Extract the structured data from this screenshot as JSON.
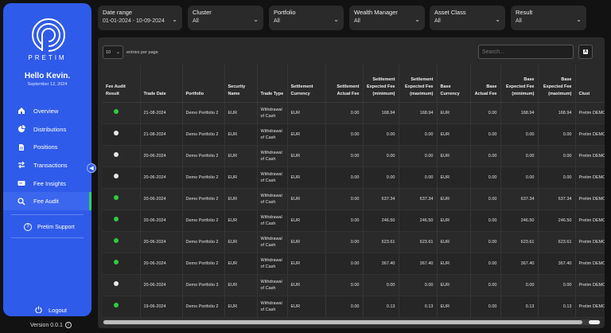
{
  "sidebar": {
    "brand": "PRETIM",
    "greeting": "Hello Kevin.",
    "date": "September 12, 2024",
    "items": [
      {
        "label": "Overview",
        "icon": "home-icon"
      },
      {
        "label": "Distributions",
        "icon": "pie-chart-icon"
      },
      {
        "label": "Positions",
        "icon": "document-icon"
      },
      {
        "label": "Transactions",
        "icon": "arrows-icon"
      },
      {
        "label": "Fee Insights",
        "icon": "fee-card-icon"
      },
      {
        "label": "Fee Audit",
        "icon": "search-icon"
      }
    ],
    "active_item": "Fee Audit",
    "support": "Pretim Support",
    "logout": "Logout",
    "version": "Version 0.0.1"
  },
  "filters": [
    {
      "label": "Date range",
      "value": "01-01-2024 - 10-09-2024"
    },
    {
      "label": "Cluster",
      "value": "All"
    },
    {
      "label": "Portfolio",
      "value": "All"
    },
    {
      "label": "Wealth Manager",
      "value": "All"
    },
    {
      "label": "Asset Class",
      "value": "All"
    },
    {
      "label": "Result",
      "value": "All"
    }
  ],
  "table_controls": {
    "entries_value": "10",
    "entries_label": "entries per page",
    "search_placeholder": "Search..."
  },
  "table": {
    "columns": [
      "Fee Audit Result",
      "Trade Date",
      "Portfolio",
      "Security Name",
      "Trade Type",
      "Settlement Currency",
      "Settlement Actual Fee",
      "Settlement Expected Fee (minimum)",
      "Settlement Expected Fee (maximum)",
      "Base Currency",
      "Base Actual Fee",
      "Base Expected Fee (minimum)",
      "Base Expected Fee (maximum)",
      "Clust"
    ],
    "rows": [
      {
        "result": "green",
        "date": "21-08-2024",
        "portfolio": "Demo Portfolio 2",
        "security": "EUR",
        "type": "Withdrawal of Cash",
        "scur": "EUR",
        "sact": "0.00",
        "smin": "168.94",
        "smax": "168.94",
        "bcur": "EUR",
        "bact": "0.00",
        "bmin": "168.94",
        "bmax": "168.94",
        "cluster": "Pretim DEMO"
      },
      {
        "result": "white",
        "date": "21-08-2024",
        "portfolio": "Demo Portfolio 2",
        "security": "EUR",
        "type": "Withdrawal of Cash",
        "scur": "EUR",
        "sact": "0.00",
        "smin": "0.00",
        "smax": "0.00",
        "bcur": "EUR",
        "bact": "0.00",
        "bmin": "0.00",
        "bmax": "0.00",
        "cluster": "Pretim DEMO"
      },
      {
        "result": "white",
        "date": "20-06-2024",
        "portfolio": "Demo Portfolio 2",
        "security": "EUR",
        "type": "Withdrawal of Cash",
        "scur": "EUR",
        "sact": "0.00",
        "smin": "0.00",
        "smax": "0.00",
        "bcur": "EUR",
        "bact": "0.00",
        "bmin": "0.00",
        "bmax": "0.00",
        "cluster": "Pretim DEMO"
      },
      {
        "result": "white",
        "date": "20-06-2024",
        "portfolio": "Demo Portfolio 2",
        "security": "EUR",
        "type": "Withdrawal of Cash",
        "scur": "EUR",
        "sact": "0.00",
        "smin": "0.00",
        "smax": "0.00",
        "bcur": "EUR",
        "bact": "0.00",
        "bmin": "0.00",
        "bmax": "0.00",
        "cluster": "Pretim DEMO"
      },
      {
        "result": "green",
        "date": "20-06-2024",
        "portfolio": "Demo Portfolio 2",
        "security": "EUR",
        "type": "Withdrawal of Cash",
        "scur": "EUR",
        "sact": "0.00",
        "smin": "637.34",
        "smax": "637.34",
        "bcur": "EUR",
        "bact": "0.00",
        "bmin": "637.34",
        "bmax": "637.34",
        "cluster": "Pretim DEMO"
      },
      {
        "result": "green",
        "date": "20-06-2024",
        "portfolio": "Demo Portfolio 2",
        "security": "EUR",
        "type": "Withdrawal of Cash",
        "scur": "EUR",
        "sact": "0.00",
        "smin": "246.50",
        "smax": "246.50",
        "bcur": "EUR",
        "bact": "0.00",
        "bmin": "246.50",
        "bmax": "246.50",
        "cluster": "Pretim DEMO"
      },
      {
        "result": "green",
        "date": "20-06-2024",
        "portfolio": "Demo Portfolio 2",
        "security": "EUR",
        "type": "Withdrawal of Cash",
        "scur": "EUR",
        "sact": "0.00",
        "smin": "623.61",
        "smax": "623.61",
        "bcur": "EUR",
        "bact": "0.00",
        "bmin": "623.61",
        "bmax": "623.61",
        "cluster": "Pretim DEMO"
      },
      {
        "result": "green",
        "date": "20-06-2024",
        "portfolio": "Demo Portfolio 2",
        "security": "EUR",
        "type": "Withdrawal of Cash",
        "scur": "EUR",
        "sact": "0.00",
        "smin": "367.40",
        "smax": "367.40",
        "bcur": "EUR",
        "bact": "0.00",
        "bmin": "367.40",
        "bmax": "367.40",
        "cluster": "Pretim DEMO"
      },
      {
        "result": "white",
        "date": "20-06-2024",
        "portfolio": "Demo Portfolio 3",
        "security": "EUR",
        "type": "Withdrawal of Cash",
        "scur": "EUR",
        "sact": "0.00",
        "smin": "0.00",
        "smax": "0.00",
        "bcur": "EUR",
        "bact": "0.00",
        "bmin": "0.00",
        "bmax": "0.00",
        "cluster": "Pretim DEMO"
      },
      {
        "result": "green",
        "date": "19-06-2024",
        "portfolio": "Demo Portfolio 2",
        "security": "EUR",
        "type": "Withdrawal of Cash",
        "scur": "EUR",
        "sact": "0.00",
        "smin": "0.13",
        "smax": "0.13",
        "bcur": "EUR",
        "bact": "0.00",
        "bmin": "0.13",
        "bmax": "0.13",
        "cluster": "Pretim DEMO"
      }
    ]
  },
  "colors": {
    "sidebar": "#2f5bea",
    "status_green": "#2ecc40",
    "status_white": "#e8e8e8",
    "active_indicator": "#2ccf6a"
  }
}
